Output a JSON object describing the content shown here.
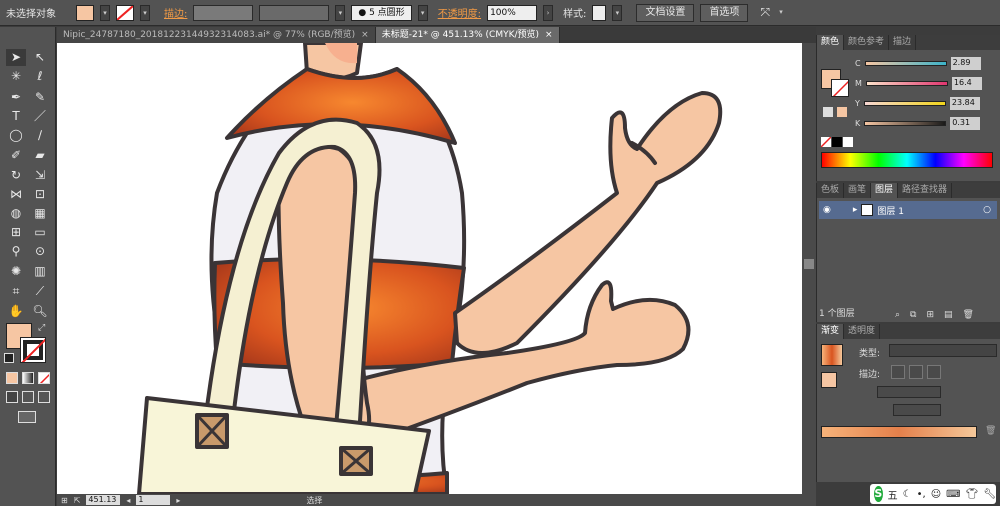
{
  "control_bar": {
    "selection_label": "未选择对象",
    "fill_color": "#f6c6a3",
    "stroke_label": "描边:",
    "brush_label": "5 点圆形",
    "opacity_label": "不透明度:",
    "opacity_value": "100%",
    "style_label": "样式:",
    "doc_setup_button": "文档设置",
    "preferences_button": "首选项"
  },
  "tabs": [
    {
      "label": "Nipic_24787180_20181223144932314083.ai* @ 77% (RGB/预览)",
      "close": "×"
    },
    {
      "label": "未标题-21* @ 451.13% (CMYK/预览)",
      "close": "×"
    }
  ],
  "status": {
    "zoom": "451.13",
    "page": "1",
    "tool": "选择"
  },
  "color_panel": {
    "tabs": [
      "颜色",
      "颜色参考",
      "描边"
    ],
    "channels": [
      {
        "label": "C",
        "value": "2.89"
      },
      {
        "label": "M",
        "value": "16.4"
      },
      {
        "label": "Y",
        "value": "23.84"
      },
      {
        "label": "K",
        "value": "0.31"
      }
    ]
  },
  "layers_panel": {
    "tabs": [
      "色板",
      "画笔",
      "图层",
      "路径查找器"
    ],
    "layer_name": "图层 1",
    "footer": "1 个图层"
  },
  "gradient_panel": {
    "tabs": [
      "渐变",
      "透明度"
    ],
    "type_label": "类型:",
    "stroke_label": "描边:"
  },
  "ime": {
    "brand": "S",
    "mode": "五"
  },
  "colors": {
    "skin": "#f6c6a3",
    "outline": "#3a3436",
    "stripe_white": "#f1f0f5",
    "stripe_orange": "#e0642a",
    "bag": "#f8f5d8",
    "bag_strap": "#f5f0d2",
    "buckle": "#c99a6b"
  }
}
